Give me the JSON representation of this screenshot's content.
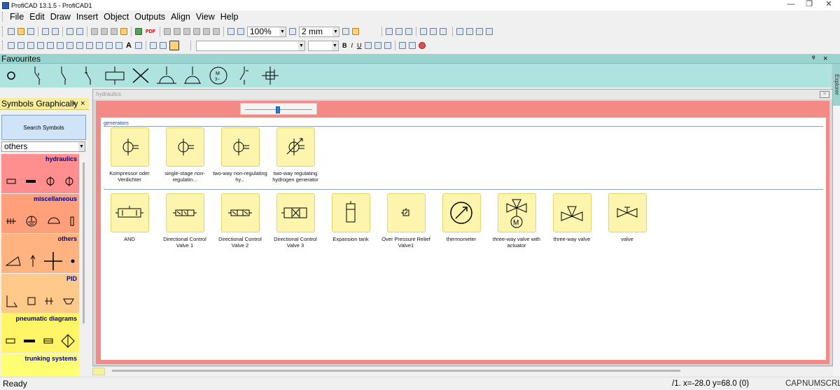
{
  "window": {
    "title": "ProfiCAD 13.1.5 - ProfiCAD1",
    "minimize": "—",
    "maximize": "❐",
    "close": "✕"
  },
  "menu": [
    "File",
    "Edit",
    "Draw",
    "Insert",
    "Object",
    "Outputs",
    "Align",
    "View",
    "Help"
  ],
  "toolbar": {
    "zoom": "100%",
    "grid": "2 mm",
    "font_name": "",
    "font_size": "",
    "bold": "B",
    "italic": "I",
    "underline": "U",
    "text_tool": "A",
    "pdf": "PDF"
  },
  "favourites": {
    "title": "Favourites",
    "pin": "ᵠ",
    "close": "×"
  },
  "explorer": {
    "label": "Explorer"
  },
  "left_panel": {
    "title": "Symbols Graphically",
    "pin": "ᵠ",
    "close": "×",
    "search": "Search Symbols",
    "selected": "others",
    "categories": [
      {
        "label": "hydraulics",
        "color": "#ff8f8f"
      },
      {
        "label": "miscellaneous",
        "color": "#ffa07a"
      },
      {
        "label": "others",
        "color": "#ffb380"
      },
      {
        "label": "PID",
        "color": "#ffc98a"
      },
      {
        "label": "pneumatic diagrams",
        "color": "#fff566"
      },
      {
        "label": "trunking systems",
        "color": "#ffff73"
      }
    ]
  },
  "doc_window": {
    "title": "hydraulics",
    "close": "✕"
  },
  "groups": [
    {
      "label": "generators",
      "items": [
        {
          "label": "Kompressor oder Verdichter",
          "icon": "compressor-icon"
        },
        {
          "label": "single-stage non-regulatin...",
          "icon": "pump-icon"
        },
        {
          "label": "two-way non-regulating hy...",
          "icon": "pump-two-way-icon"
        },
        {
          "label": "two-way regulating hydrogen generator",
          "icon": "regulating-pump-icon"
        }
      ]
    },
    {
      "label": ".",
      "items": [
        {
          "label": "AND",
          "icon": "and-valve-icon"
        },
        {
          "label": "Directional Control Valve 1",
          "icon": "directional-valve-icon"
        },
        {
          "label": "Directional Control Valve 2",
          "icon": "directional-valve-icon"
        },
        {
          "label": "Directional Control Valve 3",
          "icon": "directional-valve-icon"
        },
        {
          "label": "Expansion tank",
          "icon": "tank-icon"
        },
        {
          "label": "Over Pressure Relief Valve1",
          "icon": "relief-valve-icon"
        },
        {
          "label": "thermometer",
          "icon": "thermometer-icon"
        },
        {
          "label": "three-way valve with actuator",
          "icon": "three-way-valve-motor-icon"
        },
        {
          "label": "three-way valve",
          "icon": "three-way-valve-icon"
        },
        {
          "label": "valve",
          "icon": "valve-icon"
        }
      ]
    }
  ],
  "status": {
    "ready": "Ready",
    "coords": "/1.  x=-28.0  y=68.0 (0)",
    "cap": "CAP",
    "num": "NUM",
    "scrl": "SCRL"
  }
}
